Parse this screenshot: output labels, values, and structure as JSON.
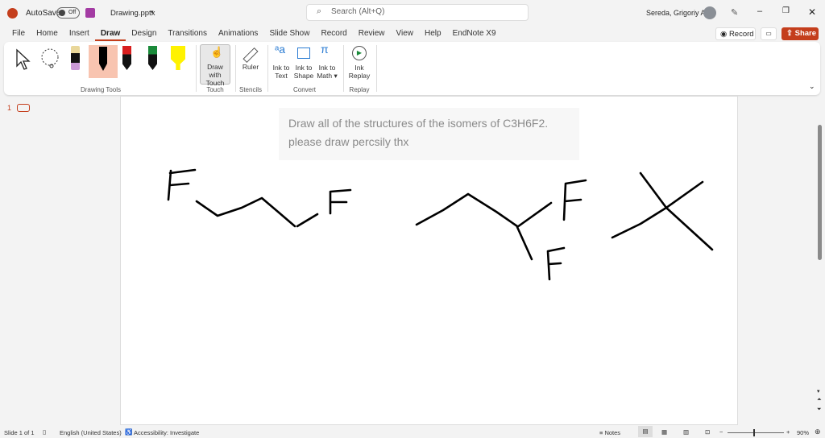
{
  "titlebar": {
    "autosave": "AutoSave",
    "toggle": "Off",
    "filename": "Drawing.pptx",
    "search_placeholder": "Search (Alt+Q)",
    "user": "Sereda, Grigoriy A"
  },
  "tabs": [
    "File",
    "Home",
    "Insert",
    "Draw",
    "Design",
    "Transitions",
    "Animations",
    "Slide Show",
    "Record",
    "Review",
    "View",
    "Help",
    "EndNote X9"
  ],
  "actions": {
    "record": "Record",
    "share": "Share"
  },
  "ribbon": {
    "groups": {
      "drawing_tools": "Drawing Tools",
      "touch": "Touch",
      "stencils": "Stencils",
      "convert": "Convert",
      "replay": "Replay"
    },
    "draw_with_touch": [
      "Draw with",
      "Touch"
    ],
    "ruler": "Ruler",
    "ink_to_text": [
      "Ink to",
      "Text"
    ],
    "ink_to_shape": [
      "Ink to",
      "Shape"
    ],
    "ink_to_math": [
      "Ink to",
      "Math"
    ],
    "ink_replay": [
      "Ink",
      "Replay"
    ],
    "pen_colors": {
      "black": "#000000",
      "red": "#d81e1e",
      "green": "#1a8a3a",
      "yellow": "#fff200"
    }
  },
  "thumbnail": {
    "number": "1"
  },
  "slide": {
    "line1": "Draw all of the structures of the isomers of C3H6F2.",
    "line2": "please draw percsily thx"
  },
  "status": {
    "slide": "Slide 1 of 1",
    "language": "English (United States)",
    "accessibility": "Accessibility: Investigate",
    "notes": "Notes",
    "zoom": "90%"
  }
}
